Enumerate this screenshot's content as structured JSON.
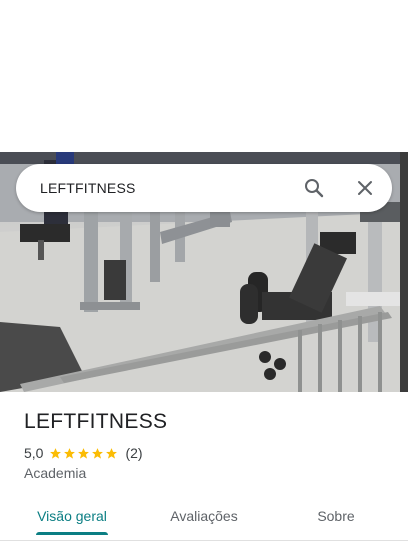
{
  "search": {
    "query": "LEFTFITNESS",
    "search_icon": "search-icon",
    "close_icon": "close-icon"
  },
  "place": {
    "name": "LEFTFITNESS",
    "rating": "5,0",
    "stars": 5,
    "review_count": "(2)",
    "category": "Academia"
  },
  "tabs": [
    {
      "label": "Visão geral",
      "active": true
    },
    {
      "label": "Avaliações",
      "active": false
    },
    {
      "label": "Sobre",
      "active": false
    }
  ],
  "colors": {
    "accent": "#0b7e83",
    "star": "#fbbc04",
    "text_primary": "#202124",
    "text_secondary": "#5f6368"
  }
}
